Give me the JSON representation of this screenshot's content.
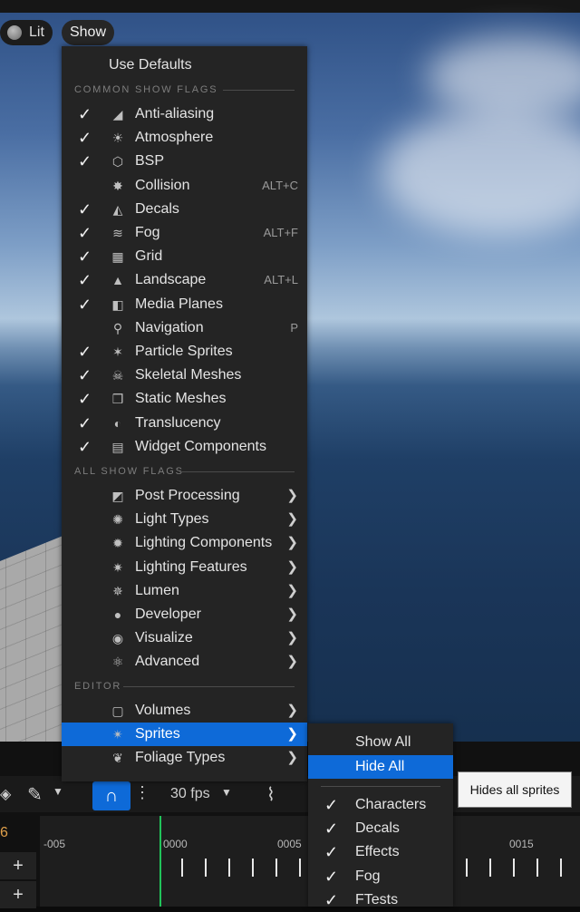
{
  "viewport": {
    "lit_label": "Lit",
    "show_label": "Show"
  },
  "menu": {
    "use_defaults": "Use Defaults",
    "common_header": "COMMON SHOW FLAGS",
    "common_items": [
      {
        "label": "Anti-aliasing",
        "checked": true,
        "shortcut": "",
        "icon": "anti-aliasing-icon"
      },
      {
        "label": "Atmosphere",
        "checked": true,
        "shortcut": "",
        "icon": "atmosphere-icon"
      },
      {
        "label": "BSP",
        "checked": true,
        "shortcut": "",
        "icon": "bsp-cube-icon"
      },
      {
        "label": "Collision",
        "checked": false,
        "shortcut": "ALT+C",
        "icon": "collision-icon"
      },
      {
        "label": "Decals",
        "checked": true,
        "shortcut": "",
        "icon": "decal-icon"
      },
      {
        "label": "Fog",
        "checked": true,
        "shortcut": "ALT+F",
        "icon": "fog-icon"
      },
      {
        "label": "Grid",
        "checked": true,
        "shortcut": "",
        "icon": "grid-icon"
      },
      {
        "label": "Landscape",
        "checked": true,
        "shortcut": "ALT+L",
        "icon": "landscape-icon"
      },
      {
        "label": "Media Planes",
        "checked": true,
        "shortcut": "",
        "icon": "media-planes-icon"
      },
      {
        "label": "Navigation",
        "checked": false,
        "shortcut": "P",
        "icon": "navigation-pin-icon"
      },
      {
        "label": "Particle Sprites",
        "checked": true,
        "shortcut": "",
        "icon": "particle-sprites-icon"
      },
      {
        "label": "Skeletal Meshes",
        "checked": true,
        "shortcut": "",
        "icon": "skeletal-mesh-icon"
      },
      {
        "label": "Static Meshes",
        "checked": true,
        "shortcut": "",
        "icon": "static-mesh-icon"
      },
      {
        "label": "Translucency",
        "checked": true,
        "shortcut": "",
        "icon": "translucency-icon"
      },
      {
        "label": "Widget Components",
        "checked": true,
        "shortcut": "",
        "icon": "widget-component-icon"
      }
    ],
    "all_header": "ALL SHOW FLAGS",
    "all_items": [
      {
        "label": "Post Processing",
        "icon": "post-processing-icon"
      },
      {
        "label": "Light Types",
        "icon": "light-types-icon"
      },
      {
        "label": "Lighting Components",
        "icon": "lighting-components-icon"
      },
      {
        "label": "Lighting Features",
        "icon": "lighting-features-icon"
      },
      {
        "label": "Lumen",
        "icon": "lumen-icon"
      },
      {
        "label": "Developer",
        "icon": "developer-person-icon"
      },
      {
        "label": "Visualize",
        "icon": "visualize-eye-icon"
      },
      {
        "label": "Advanced",
        "icon": "advanced-atom-icon"
      }
    ],
    "editor_header": "EDITOR",
    "editor_items": [
      {
        "label": "Volumes",
        "icon": "volumes-icon",
        "highlighted": false
      },
      {
        "label": "Sprites",
        "icon": "sprites-icon",
        "highlighted": true
      },
      {
        "label": "Foliage Types",
        "icon": "foliage-icon",
        "highlighted": false
      }
    ]
  },
  "submenu": {
    "show_all": "Show All",
    "hide_all": "Hide All",
    "items": [
      "Characters",
      "Decals",
      "Effects",
      "Fog",
      "FTests"
    ]
  },
  "tooltip": "Hides all sprites",
  "toolbar": {
    "fps": "30 fps",
    "frame_marker": "6"
  },
  "timeline": {
    "ruler_labels": [
      "-005",
      "0000",
      "0005",
      "0015"
    ]
  }
}
